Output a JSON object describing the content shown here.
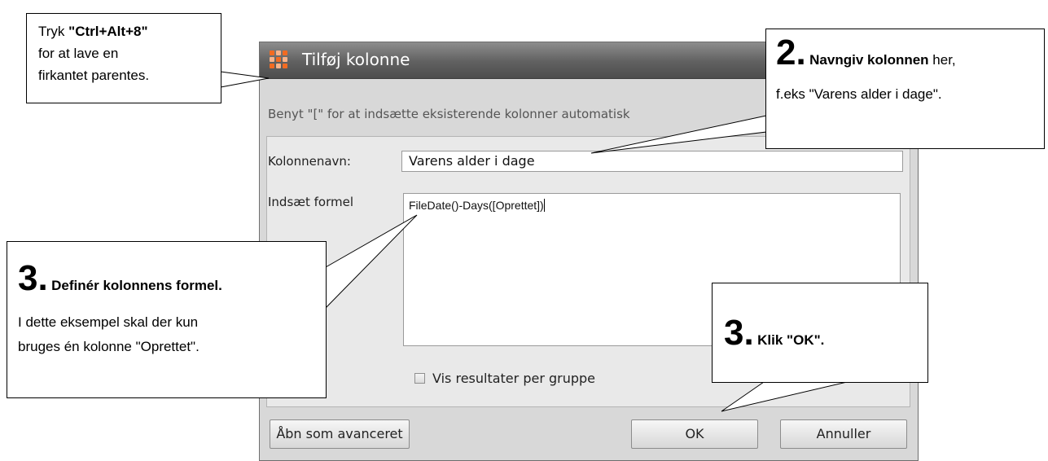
{
  "dialog": {
    "title": "Tilføj kolonne",
    "hint": "Benyt \"[\" for at indsætte eksisterende kolonner automatisk",
    "column_name_label": "Kolonnenavn:",
    "column_name_value": "Varens alder i dage",
    "formula_label": "Indsæt formel",
    "formula_value": "FileDate()-Days([Oprettet])",
    "checkbox_label": "Vis resultater per gruppe",
    "checkbox_checked": false,
    "buttons": {
      "advanced": "Åbn som avanceret",
      "ok": "OK",
      "cancel": "Annuller"
    },
    "icon": "app-grid-icon",
    "accent_color": "#f26b21"
  },
  "callouts": {
    "c1": {
      "line1_prefix": "Tryk ",
      "line1_bold": "\"Ctrl+Alt+8\"",
      "line2": "for at lave en",
      "line3": "firkantet parentes."
    },
    "c2": {
      "number": "2.",
      "bold": "Navngiv kolonnen",
      "text": " her,",
      "line2": "f.eks \"Varens alder i dage\"."
    },
    "c3": {
      "number": "3.",
      "bold": "Definér kolonnens formel.",
      "line2": "I dette eksempel skal der kun",
      "line3": "bruges én kolonne \"Oprettet\"."
    },
    "c4": {
      "number": "3.",
      "bold": "Klik \"OK\"."
    }
  }
}
